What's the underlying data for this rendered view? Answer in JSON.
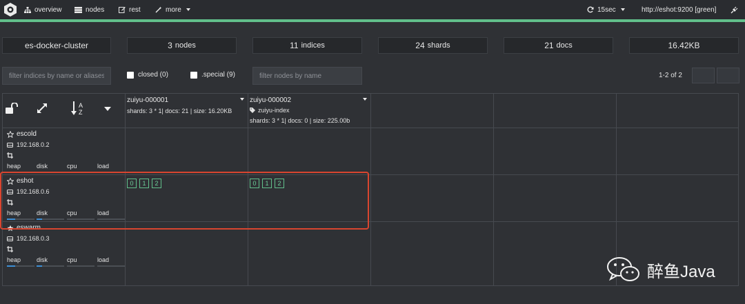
{
  "navbar": {
    "items": [
      {
        "label": "overview",
        "icon": "sitemap-icon"
      },
      {
        "label": "nodes",
        "icon": "server-icon"
      },
      {
        "label": "rest",
        "icon": "edit-icon"
      },
      {
        "label": "more",
        "icon": "magic-wand-icon"
      }
    ],
    "refresh": "15sec",
    "connection": "http://eshot:9200 [green]",
    "accent_color": "#62c08b"
  },
  "stats": {
    "cluster_name": "es-docker-cluster",
    "nodes": {
      "value": "3",
      "label": "nodes"
    },
    "indices": {
      "value": "11",
      "label": "indices"
    },
    "shards": {
      "value": "24",
      "label": "shards"
    },
    "docs": {
      "value": "21",
      "label": "docs"
    },
    "size": "16.42KB"
  },
  "filters": {
    "indices_placeholder": "filter indices by name or aliases",
    "closed_label": "closed (0)",
    "special_label": ".special (9)",
    "nodes_placeholder": "filter nodes by name",
    "pager": "1-2 of 2"
  },
  "indices": [
    {
      "name": "zuiyu-000001",
      "meta": "shards: 3 * 1| docs: 21 | size: 16.20KB",
      "alias": ""
    },
    {
      "name": "zuiyu-000002",
      "meta": "shards: 3 * 1| docs: 0 | size: 225.00b",
      "alias": "zuiyu-index"
    }
  ],
  "nodes": [
    {
      "name": "escold",
      "ip": "192.168.0.2",
      "master": false,
      "heap": 0,
      "disk": 0,
      "shards": []
    },
    {
      "name": "eshot",
      "ip": "192.168.0.6",
      "master": false,
      "heap": 0.3,
      "disk": 0.2,
      "shards": [
        [
          "0",
          "1",
          "2"
        ],
        [
          "0",
          "1",
          "2"
        ]
      ]
    },
    {
      "name": "eswarm",
      "ip": "192.168.0.3",
      "master": true,
      "heap": 0.3,
      "disk": 0.2,
      "shards": []
    }
  ],
  "metric_labels": {
    "heap": "heap",
    "disk": "disk",
    "cpu": "cpu",
    "load": "load"
  },
  "watermark": {
    "text": "醉鱼Java",
    "icon": "wechat-icon"
  }
}
